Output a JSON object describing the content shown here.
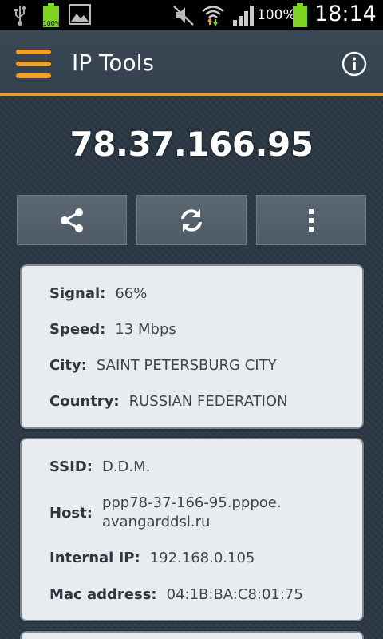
{
  "status_bar": {
    "battery_small_label": "100%",
    "battery_percent": "100%",
    "time": "18:14"
  },
  "app": {
    "title": "IP Tools"
  },
  "ip": {
    "address": "78.37.166.95"
  },
  "actions": [
    "share",
    "refresh",
    "more"
  ],
  "network_info": {
    "signal": {
      "label": "Signal:",
      "value": "66%"
    },
    "speed": {
      "label": "Speed:",
      "value": "13 Mbps"
    },
    "city": {
      "label": "City:",
      "value": "SAINT PETERSBURG CITY"
    },
    "country": {
      "label": "Country:",
      "value": "RUSSIAN FEDERATION"
    }
  },
  "wifi_info": {
    "ssid": {
      "label": "SSID:",
      "value": "D.D.M."
    },
    "host": {
      "label": "Host:",
      "value_line1": "ppp78-37-166-95.pppoe.",
      "value_line2": "avangarddsl.ru"
    },
    "internal_ip": {
      "label": "Internal IP:",
      "value": "192.168.0.105"
    },
    "mac": {
      "label": "Mac address:",
      "value": "04:1B:BA:C8:01:75"
    }
  },
  "colors": {
    "accent": "#f5a020",
    "battery": "#7ed321",
    "background": "#2c3945",
    "card": "#e9ecee"
  }
}
